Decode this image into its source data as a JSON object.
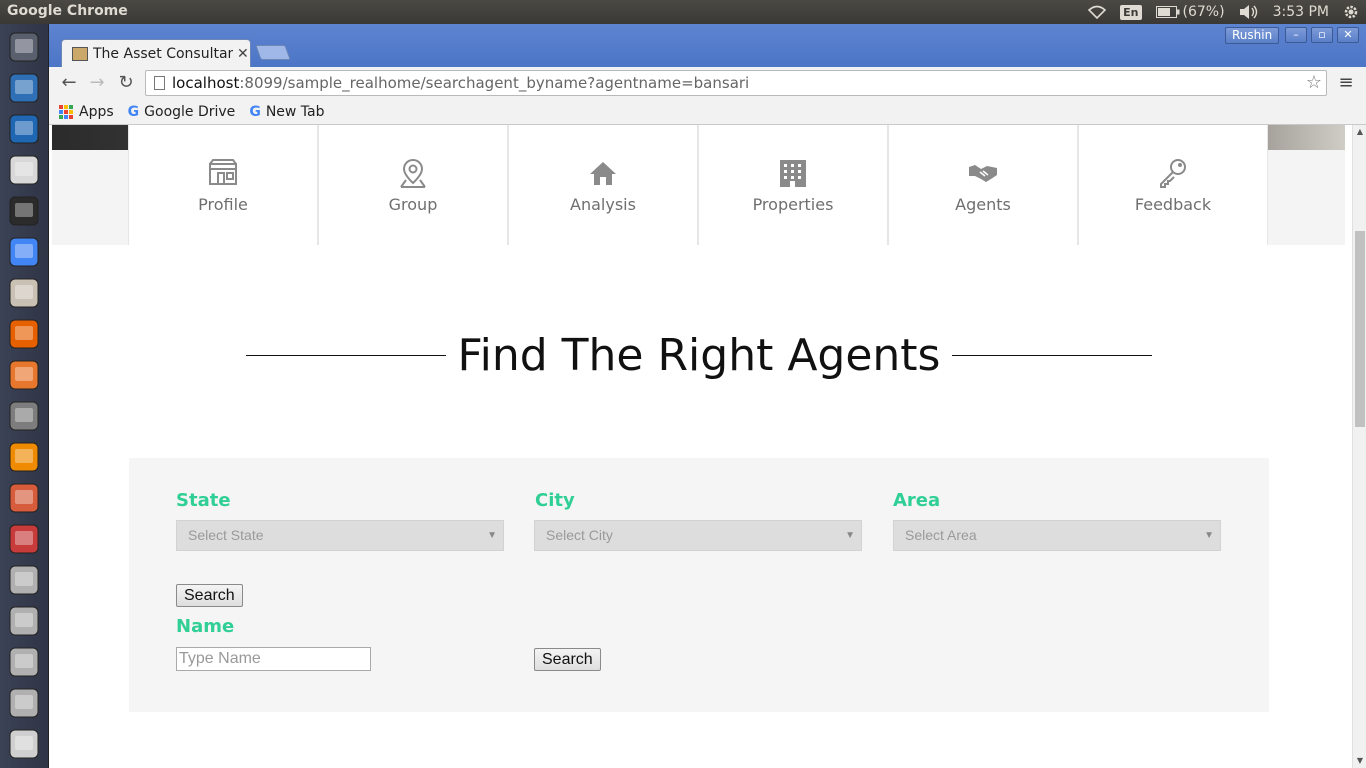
{
  "os": {
    "app_name": "Google Chrome",
    "lang": "En",
    "battery": "(67%)",
    "clock": "3:53 PM",
    "tray_icons": [
      "wifi-icon",
      "battery-icon",
      "volume-icon",
      "settings-gear-icon"
    ]
  },
  "launcher": {
    "items": [
      "ubuntu-dash-icon",
      "network-tool-icon",
      "virtualbox-icon",
      "text-editor-icon",
      "terminal-icon",
      "chrome-icon",
      "archive-manager-icon",
      "firefox-icon",
      "software-center-icon",
      "system-settings-icon",
      "vlc-icon",
      "file-roller-icon",
      "app-icon",
      "drive-icon",
      "drive-icon",
      "drive-icon",
      "drive-icon",
      "dvd-icon"
    ]
  },
  "browser": {
    "tab_title": "The Asset Consultan",
    "profile": "Rushin",
    "url_host": "localhost",
    "url_rest": ":8099/sample_realhome/searchagent_byname?agentname=bansari",
    "bookmarks": [
      "Apps",
      "Google Drive",
      "New Tab"
    ]
  },
  "page": {
    "nav": [
      {
        "label": "Profile",
        "icon": "store-icon"
      },
      {
        "label": "Group",
        "icon": "map-pin-icon"
      },
      {
        "label": "Analysis",
        "icon": "home-icon"
      },
      {
        "label": "Properties",
        "icon": "building-icon"
      },
      {
        "label": "Agents",
        "icon": "handshake-icon"
      },
      {
        "label": "Feedback",
        "icon": "key-icon"
      }
    ],
    "heading": "Find The Right Agents",
    "form": {
      "state_label": "State",
      "state_placeholder": "Select State",
      "city_label": "City",
      "city_placeholder": "Select City",
      "area_label": "Area",
      "area_placeholder": "Select Area",
      "search_label": "Search",
      "name_label": "Name",
      "name_placeholder": "Type Name",
      "name_search_label": "Search"
    }
  },
  "colors": {
    "accent_green": "#2fcf95",
    "chrome_blue": "#4c75c6"
  }
}
